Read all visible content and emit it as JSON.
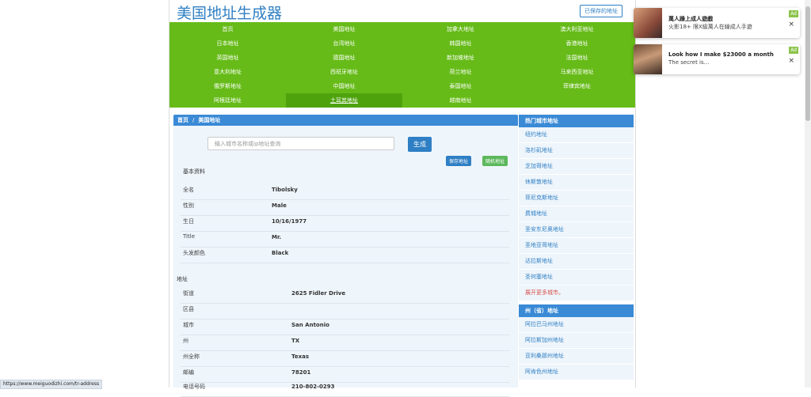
{
  "header": {
    "title": "美国地址生成器",
    "saved_link": "已保存的地址"
  },
  "nav": [
    "首页",
    "美国地址",
    "加拿大地址",
    "澳大利亚地址",
    "日本地址",
    "台湾地址",
    "韩国地址",
    "香港地址",
    "英国地址",
    "德国地址",
    "新加坡地址",
    "法国地址",
    "意大利地址",
    "西班牙地址",
    "荷兰地址",
    "马来西亚地址",
    "俄罗斯地址",
    "中国地址",
    "泰国地址",
    "菲律宾地址",
    "阿根廷地址",
    "土耳其地址",
    "越南地址"
  ],
  "breadcrumb": {
    "home": "首页",
    "sep": "/",
    "current": "美国地址"
  },
  "search": {
    "placeholder": "输入城市名称或ip地址查询",
    "button": "生成"
  },
  "actions": {
    "save": "保存地址",
    "random": "随机地址"
  },
  "basic": {
    "title": "基本资料",
    "rows": [
      {
        "label": "全名",
        "value": "Tibolsky"
      },
      {
        "label": "性别",
        "value": "Male"
      },
      {
        "label": "生日",
        "value": "10/16/1977"
      },
      {
        "label": "Title",
        "value": "Mr."
      },
      {
        "label": "头发颜色",
        "value": "Black"
      }
    ]
  },
  "address": {
    "title": "地址",
    "rows": [
      {
        "label": "街道",
        "value": "2625  Fidler Drive"
      },
      {
        "label": "区县",
        "value": ""
      },
      {
        "label": "城市",
        "value": "San Antonio"
      },
      {
        "label": "州",
        "value": "TX"
      },
      {
        "label": "州全称",
        "value": "Texas"
      },
      {
        "label": "邮编",
        "value": "78201"
      },
      {
        "label": "电话号码",
        "value": "210-802-0293"
      }
    ]
  },
  "sidebar": {
    "hot_title": "热门城市地址",
    "hot_items": [
      "纽约地址",
      "洛杉矶地址",
      "芝加哥地址",
      "休斯敦地址",
      "菲尼克斯地址",
      "费城地址",
      "圣安东尼奥地址",
      "圣地亚哥地址",
      "达拉斯地址",
      "圣何塞地址"
    ],
    "more": "展开更多城市。",
    "state_title": "州（省）地址",
    "state_items": [
      "阿拉巴马州地址",
      "阿拉斯加州地址",
      "亚利桑那州地址",
      "阿肯色州地址"
    ]
  },
  "ads": [
    {
      "title": "萬人躁上成人遊戲",
      "subtitle": "火影18+ 限X級萬人在線成人手遊",
      "badge": "Ad",
      "close": "×"
    },
    {
      "title": "Look how I make $23000 a month",
      "subtitle": "The secret is...",
      "badge": "Ad",
      "close": "×"
    }
  ],
  "status_url": "https://www.meiguodizhi.com/tr-address",
  "colors": {
    "nav_green": "#66bb18",
    "accent_blue": "#2f7fc4",
    "panel_blue": "#3a8ad6",
    "panel_bg": "#eef5fb"
  }
}
